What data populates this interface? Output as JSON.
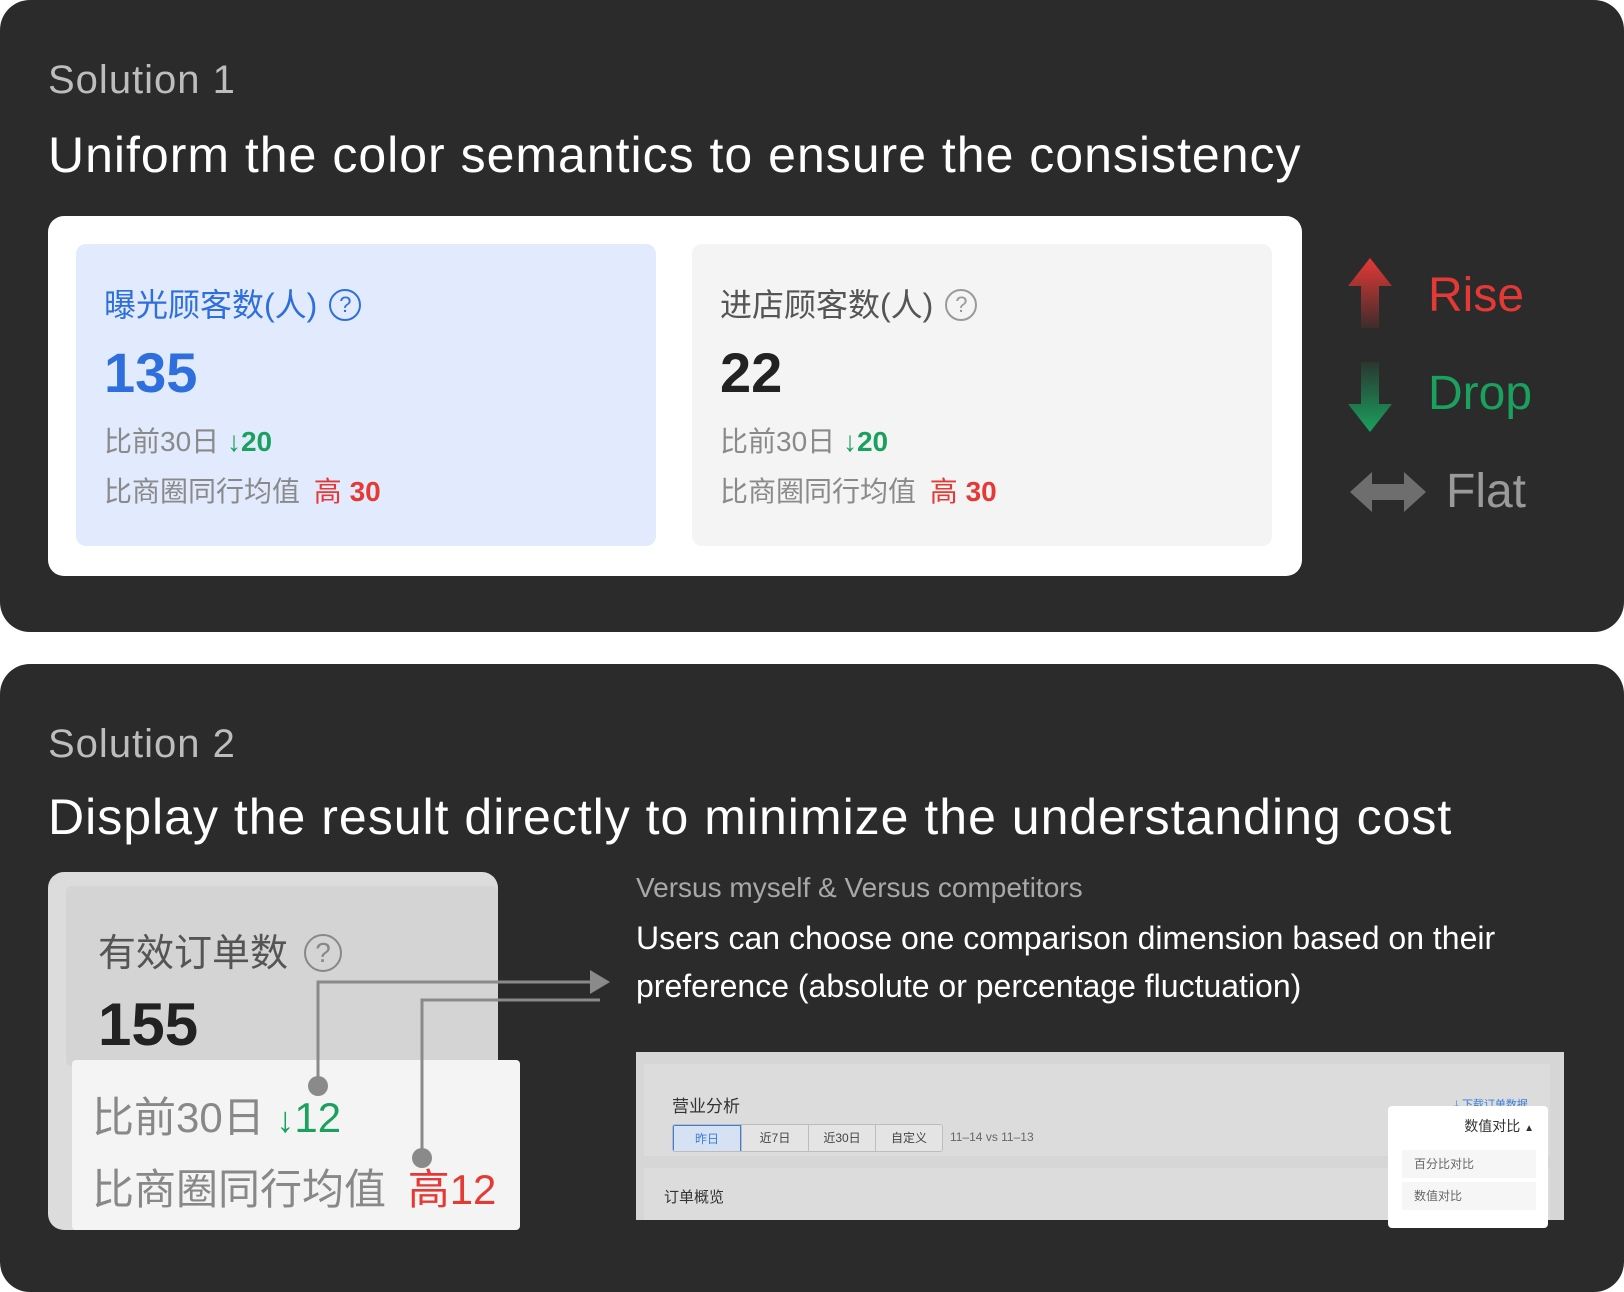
{
  "solution1": {
    "label": "Solution 1",
    "heading": "Uniform the color semantics to ensure the consistency",
    "cards": [
      {
        "title": "曝光顾客数(人)",
        "value": "135",
        "compare1_label": "比前30日",
        "compare1_arrow": "↓",
        "compare1_value": "20",
        "compare2_label": "比商圈同行均值",
        "compare2_tag": "高",
        "compare2_value": "30"
      },
      {
        "title": "进店顾客数(人)",
        "value": "22",
        "compare1_label": "比前30日",
        "compare1_arrow": "↓",
        "compare1_value": "20",
        "compare2_label": "比商圈同行均值",
        "compare2_tag": "高",
        "compare2_value": "30"
      }
    ],
    "legend": {
      "rise": "Rise",
      "drop": "Drop",
      "flat": "Flat"
    }
  },
  "solution2": {
    "label": "Solution 2",
    "heading": "Display the result directly to minimize the understanding cost",
    "card": {
      "title": "有效订单数",
      "value": "155",
      "compare1_label": "比前30日",
      "compare1_arrow": "↓",
      "compare1_value": "12",
      "compare2_label": "比商圈同行均值",
      "compare2_tag": "高",
      "compare2_value": "12"
    },
    "subtitle": "Versus myself & Versus competitors",
    "description": "Users can choose one comparison dimension based on their preference (absolute or percentage fluctuation)",
    "mini_ui": {
      "title": "营业分析",
      "download": "下载订单数据",
      "tabs": [
        "昨日",
        "近7日",
        "近30日",
        "自定义"
      ],
      "active_tab": "昨日",
      "range": "11–14 vs 11–13",
      "section_title": "订单概览",
      "dropdown": {
        "selected": "数值对比",
        "options": [
          "百分比对比",
          "数值对比"
        ]
      }
    }
  },
  "colors": {
    "rise": "#e53935",
    "drop": "#1aa15e",
    "flat": "#8a8a8a",
    "brand_blue": "#2f6fdd"
  }
}
